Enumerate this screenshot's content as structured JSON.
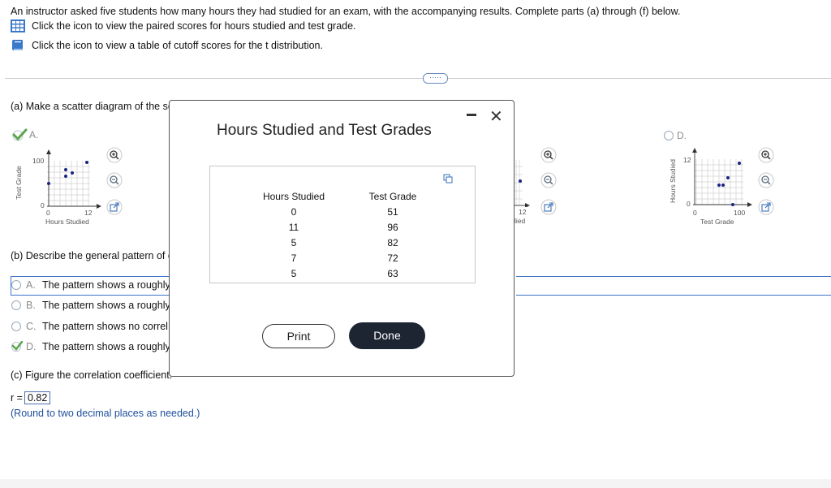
{
  "intro": "An instructor asked five students how many hours they had studied for an exam, with the accompanying results. Complete parts (a) through (f) below.",
  "links": [
    {
      "icon": "grid-table-icon",
      "text": "Click the icon to view the paired scores for hours studied and test grade."
    },
    {
      "icon": "book-icon",
      "text": "Click the icon to view a table of cutoff scores for the t distribution."
    }
  ],
  "more_label": "·····",
  "part_a": {
    "prompt": "(a) Make a scatter diagram of the sc",
    "option_a": {
      "letter": "A.",
      "ylabel": "Test Grade",
      "xlabel": "Hours Studied",
      "ymax": "100",
      "x0": "0",
      "xmax": "12",
      "y0": "0"
    },
    "option_c": {
      "xmax": "12",
      "xlabel_partial": "lied"
    },
    "option_d": {
      "letter": "D.",
      "ylabel": "Hours Studied",
      "xlabel": "Test Grade",
      "ymax": "12",
      "x0": "0",
      "xmax": "100",
      "y0": "0"
    }
  },
  "part_b": {
    "prompt": "(b) Describe the general pattern of c",
    "options": [
      {
        "letter": "A.",
        "text": "The pattern shows a roughly"
      },
      {
        "letter": "B.",
        "text": "The pattern shows a roughly"
      },
      {
        "letter": "C.",
        "text": "The pattern shows no correl"
      },
      {
        "letter": "D.",
        "text": "The pattern shows a roughly"
      }
    ]
  },
  "part_c": {
    "prompt": "(c) Figure the correlation coefficient.",
    "r_label": "r =",
    "r_value": "0.82",
    "hint": "(Round to two decimal places as needed.)"
  },
  "modal": {
    "title": "Hours Studied and Test Grades",
    "col1_header": "Hours Studied",
    "col2_header": "Test Grade",
    "hours": [
      "0",
      "11",
      "5",
      "7",
      "5"
    ],
    "grades": [
      "51",
      "96",
      "82",
      "72",
      "63"
    ],
    "print_label": "Print",
    "done_label": "Done"
  }
}
